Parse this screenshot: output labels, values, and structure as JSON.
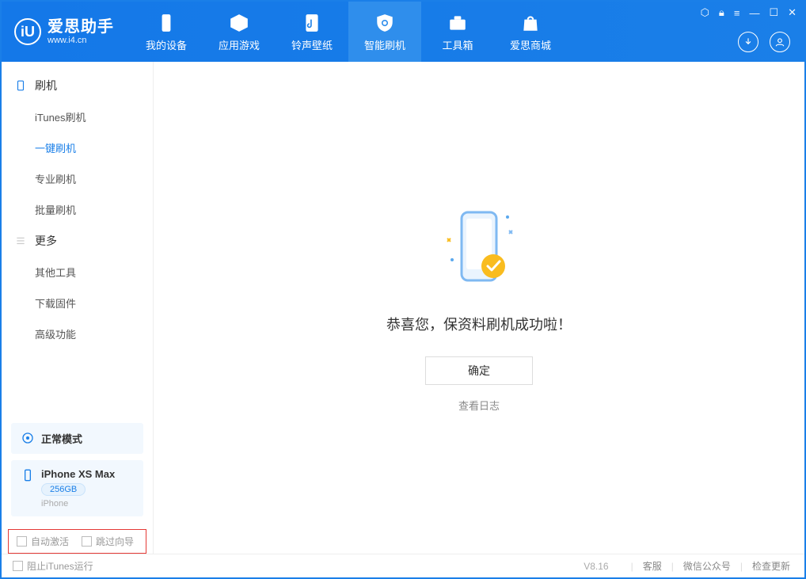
{
  "logo": {
    "icon_letter": "iU",
    "cn": "爱思助手",
    "url": "www.i4.cn"
  },
  "tabs": [
    {
      "label": "我的设备"
    },
    {
      "label": "应用游戏"
    },
    {
      "label": "铃声壁纸"
    },
    {
      "label": "智能刷机"
    },
    {
      "label": "工具箱"
    },
    {
      "label": "爱思商城"
    }
  ],
  "sidebar": {
    "group1": {
      "title": "刷机"
    },
    "items1": [
      {
        "label": "iTunes刷机"
      },
      {
        "label": "一键刷机"
      },
      {
        "label": "专业刷机"
      },
      {
        "label": "批量刷机"
      }
    ],
    "group2": {
      "title": "更多"
    },
    "items2": [
      {
        "label": "其他工具"
      },
      {
        "label": "下载固件"
      },
      {
        "label": "高级功能"
      }
    ]
  },
  "device": {
    "mode": "正常模式",
    "name": "iPhone XS Max",
    "capacity": "256GB",
    "type": "iPhone"
  },
  "checkboxes": {
    "auto_activate": "自动激活",
    "skip_guide": "跳过向导"
  },
  "main": {
    "success_message": "恭喜您，保资料刷机成功啦！",
    "ok_button": "确定",
    "log_link": "查看日志"
  },
  "footer": {
    "block_itunes": "阻止iTunes运行",
    "version": "V8.16",
    "links": [
      "客服",
      "微信公众号",
      "检查更新"
    ]
  }
}
